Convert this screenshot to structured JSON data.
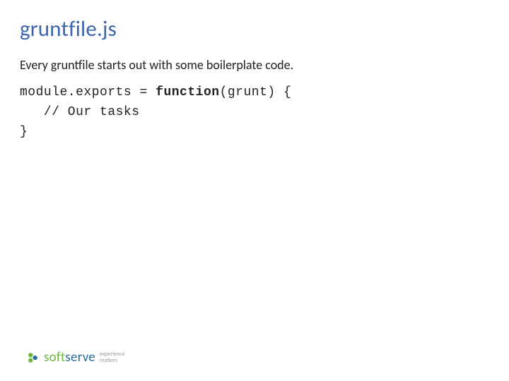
{
  "title": "gruntfile.js",
  "intro": "Every gruntfile starts out with some boilerplate code.",
  "code": {
    "line1a": "module.exports = ",
    "line1b": "function",
    "line1c": "(grunt) {",
    "line2": "   // Our tasks",
    "line3": "}"
  },
  "logo": {
    "soft": "soft",
    "serve": "serve",
    "tag1": "experience",
    "tag2": "matters"
  }
}
